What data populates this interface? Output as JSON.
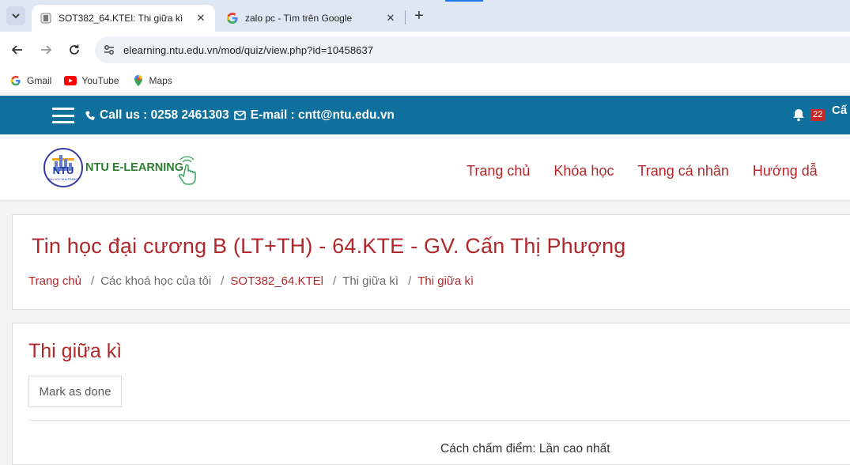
{
  "browser": {
    "tabs": [
      {
        "title": "SOT382_64.KTEl: Thi giữa kì",
        "active": true,
        "favicon": "moodle-favicon-icon"
      },
      {
        "title": "zalo pc - Tìm trên Google",
        "active": false,
        "favicon": "google-g-icon"
      }
    ],
    "url": "elearning.ntu.edu.vn/mod/quiz/view.php?id=10458637",
    "bookmarks": [
      {
        "label": "Gmail",
        "icon": "google-g-icon"
      },
      {
        "label": "YouTube",
        "icon": "youtube-icon"
      },
      {
        "label": "Maps",
        "icon": "maps-icon"
      }
    ]
  },
  "header": {
    "call_label": "Call us : 0258 2461303",
    "email_label": "E-mail : cntt@ntu.edu.vn",
    "notification_count": "22",
    "user_fragment": "Cấ",
    "brand_color": "#0f6f9d",
    "accent_color": "#b0282b"
  },
  "logo": {
    "badge_text": "NTU",
    "wordmark": "NTU E-LEARNING"
  },
  "nav": {
    "items": [
      "Trang chủ",
      "Khóa học",
      "Trang cá nhân",
      "Hướng dẫ"
    ]
  },
  "course": {
    "title": "Tin học đại cương B (LT+TH) - 64.KTE - GV. Cấn Thị Phượng",
    "breadcrumb": [
      {
        "label": "Trang chủ",
        "link": true
      },
      {
        "label": "Các khoá học của tôi",
        "link": false
      },
      {
        "label": "SOT382_64.KTEl",
        "link": true
      },
      {
        "label": "Thi giữa kì",
        "link": false
      },
      {
        "label": "Thi giữa kì",
        "link": true
      }
    ]
  },
  "quiz": {
    "title": "Thi giữa kì",
    "mark_done_label": "Mark as done",
    "grading_text": "Cách chấm điểm: Lần cao nhất"
  }
}
